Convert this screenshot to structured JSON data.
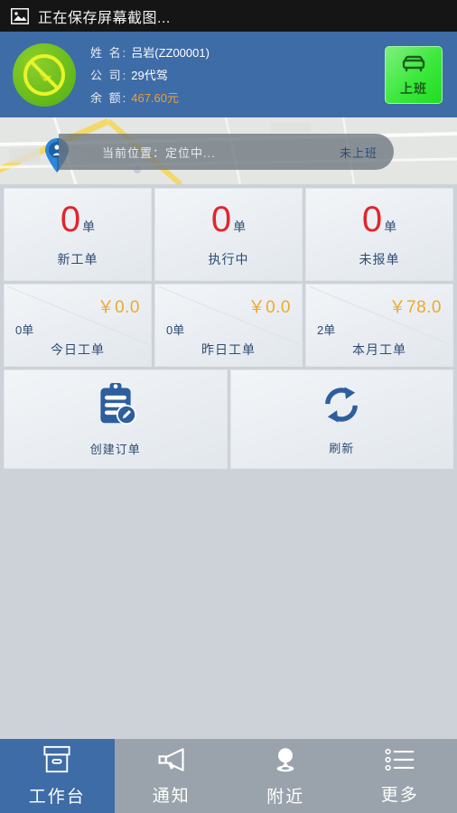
{
  "statusbar": {
    "icon": "image-icon",
    "text": "正在保存屏幕截图..."
  },
  "profile": {
    "avatar_icon": "no-drunk-driving-icon",
    "rows": [
      {
        "label": "姓 名:",
        "value": "吕岩(ZZ00001)"
      },
      {
        "label": "公 司:",
        "value": "29代驾"
      },
      {
        "label": "余 额:",
        "value": "467.60元"
      }
    ],
    "shift_button": {
      "icon": "car-icon",
      "label": "上班"
    }
  },
  "map": {
    "pin_icon": "map-pin-icon",
    "location_label": "当前位置：",
    "location_value": "定位中...",
    "work_status": "未上班"
  },
  "counts": [
    {
      "num": "0",
      "unit": "单",
      "label": "新工单"
    },
    {
      "num": "0",
      "unit": "单",
      "label": "执行中"
    },
    {
      "num": "0",
      "unit": "单",
      "label": "未报单"
    }
  ],
  "money": [
    {
      "amount": "￥0.0",
      "count": "0单",
      "label": "今日工单"
    },
    {
      "amount": "￥0.0",
      "count": "0单",
      "label": "昨日工单"
    },
    {
      "amount": "￥78.0",
      "count": "2单",
      "label": "本月工单"
    }
  ],
  "actions": [
    {
      "icon": "clipboard-edit-icon",
      "label": "创建订单"
    },
    {
      "icon": "refresh-icon",
      "label": "刷新"
    }
  ],
  "tabs": [
    {
      "icon": "box-icon",
      "label": "工作台",
      "active": true
    },
    {
      "icon": "megaphone-icon",
      "label": "通知",
      "active": false
    },
    {
      "icon": "location-pin-icon",
      "label": "附近",
      "active": false
    },
    {
      "icon": "list-icon",
      "label": "更多",
      "active": false
    }
  ],
  "colors": {
    "header_blue": "#3e6ca7",
    "accent_green": "#3ce83c",
    "count_red": "#e1252c",
    "money_orange": "#f0a82a",
    "text_blue": "#2d4b74",
    "page_bg": "#ccd2d8"
  }
}
